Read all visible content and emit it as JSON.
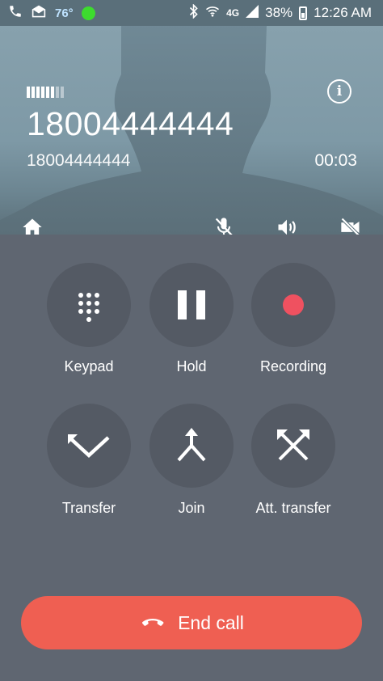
{
  "status_bar": {
    "temperature": "76°",
    "network": "4G",
    "battery": "38%",
    "time": "12:26 AM",
    "icons": [
      "phone-icon",
      "mail-icon",
      "weather-status-icon",
      "bluetooth-icon",
      "wifi-icon",
      "signal-icon",
      "battery-icon"
    ]
  },
  "call": {
    "display_number": "18004444444",
    "sub_number": "18004444444",
    "duration": "00:03",
    "signal_strength": 0.75
  },
  "header_actions": [
    "home-icon",
    "mute-mic-icon",
    "speaker-icon",
    "video-off-icon"
  ],
  "controls": [
    {
      "label": "Keypad",
      "icon": "keypad-icon"
    },
    {
      "label": "Hold",
      "icon": "pause-icon"
    },
    {
      "label": "Recording",
      "icon": "record-icon"
    },
    {
      "label": "Transfer",
      "icon": "transfer-icon"
    },
    {
      "label": "Join",
      "icon": "join-icon"
    },
    {
      "label": "Att. transfer",
      "icon": "attended-transfer-icon"
    }
  ],
  "end_call": {
    "label": "End call"
  },
  "colors": {
    "end_call": "#ef5f52",
    "record": "#ef5160",
    "background": "#5f6671"
  }
}
